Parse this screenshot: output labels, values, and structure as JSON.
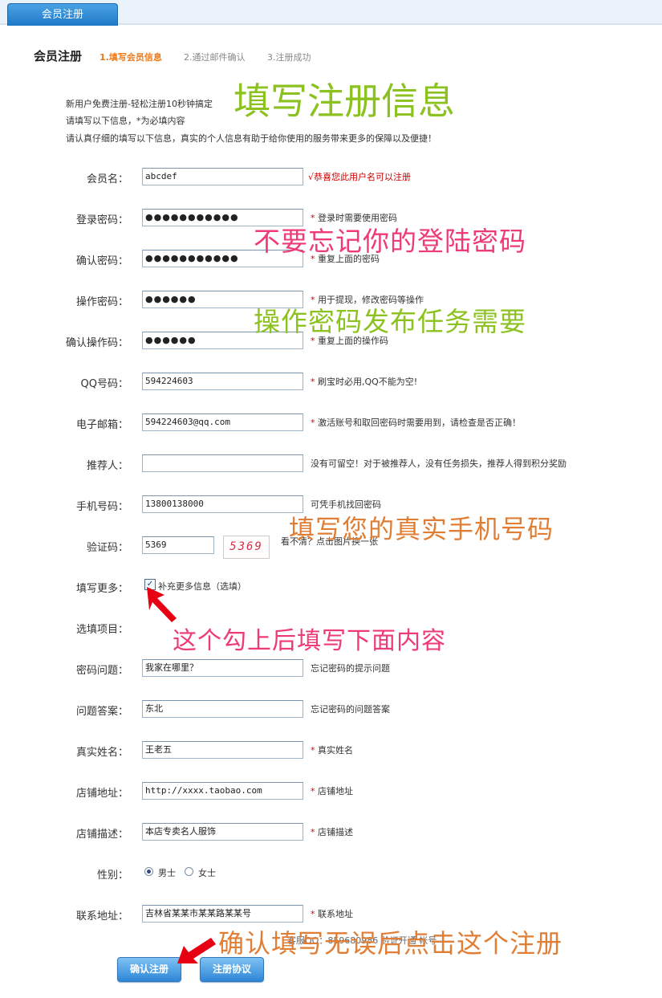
{
  "top_tab": {
    "label": "会员注册"
  },
  "header": {
    "title": "会员注册",
    "steps": [
      "1.填写会员信息",
      "2.通过邮件确认",
      "3.注册成功"
    ]
  },
  "intro": [
    "新用户免费注册-轻松注册10秒钟搞定",
    "请填写以下信息，*为必填内容",
    "请认真仔细的填写以下信息，真实的个人信息有助于给你使用的服务带来更多的保障以及便捷！"
  ],
  "form": {
    "username": {
      "label": "会员名：",
      "value": "abcdef",
      "status": "√恭喜您此用户名可以注册"
    },
    "password": {
      "label": "登录密码：",
      "mask": "●●●●●●●●●●●",
      "hint": "登录时需要使用密码"
    },
    "password_confirm": {
      "label": "确认密码：",
      "mask": "●●●●●●●●●●●",
      "hint": "重复上面的密码"
    },
    "op_password": {
      "label": "操作密码：",
      "mask": "●●●●●●",
      "hint": "用于提现，修改密码等操作"
    },
    "op_password_confirm": {
      "label": "确认操作码：",
      "mask": "●●●●●●",
      "hint": "重复上面的操作码"
    },
    "qq": {
      "label": "QQ号码：",
      "value": "594224603",
      "hint": "刷宝时必用,QQ不能为空!"
    },
    "email": {
      "label": "电子邮箱：",
      "value": "594224603@qq.com",
      "hint": "激活账号和取回密码时需要用到，请检查是否正确！"
    },
    "referrer": {
      "label": "推荐人：",
      "value": "",
      "hint": "没有可留空！对于被推荐人，没有任务损失，推荐人得到积分奖励"
    },
    "phone": {
      "label": "手机号码：",
      "value": "13800138000",
      "hint": "可凭手机找回密码"
    },
    "captcha": {
      "label": "验证码：",
      "value": "5369",
      "image_text": "5369",
      "hint": "看不清？点击图片换一张"
    },
    "more": {
      "label": "填写更多：",
      "checkbox_label": "补充更多信息（选填）",
      "checked": true
    },
    "optional_label": "选填项目：",
    "security_q": {
      "label": "密码问题：",
      "value": "我家在哪里？",
      "hint": "忘记密码的提示问题"
    },
    "security_a": {
      "label": "问题答案：",
      "value": "东北",
      "hint": "忘记密码的问题答案"
    },
    "real_name": {
      "label": "真实姓名：",
      "value": "王老五",
      "hint": "真实姓名"
    },
    "shop_url": {
      "label": "店铺地址：",
      "value": "http://xxxx.taobao.com",
      "hint": "店铺地址"
    },
    "shop_desc": {
      "label": "店铺描述：",
      "value": "本店专卖名人服饰",
      "hint": "店铺描述"
    },
    "gender": {
      "label": "性别：",
      "options": [
        "男士",
        "女士"
      ],
      "selected": "男士"
    },
    "address": {
      "label": "联系地址：",
      "value": "吉林省某某市某某路某某号",
      "hint": "联系地址"
    },
    "note": "客服QQ：859680986 验证开通 帐号"
  },
  "buttons": {
    "submit": "确认注册",
    "agreement": "注册协议"
  },
  "annotations": {
    "a1": "填写注册信息",
    "a2": "不要忘记你的登陆密码",
    "a3": "操作密码发布任务需要",
    "a4": "填写您的真实手机号码",
    "a5": "这个勾上后填写下面内容",
    "a6": "确认填写无误后点击这个注册"
  },
  "colors": {
    "accent": "#ee7a1a",
    "required": "#dd0000",
    "annotation_green": "#8cc21f",
    "annotation_pink": "#ee3a78",
    "annotation_orange": "#e07e35"
  }
}
